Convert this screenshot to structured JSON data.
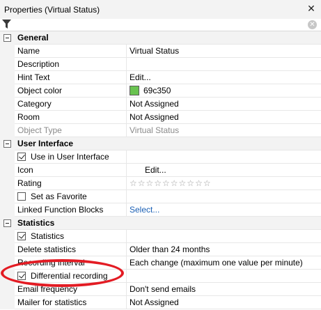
{
  "panel": {
    "title": "Properties (Virtual Status)"
  },
  "filter": {
    "placeholder": ""
  },
  "colors": {
    "object_color": "#69c350",
    "annotation": "#e31b23"
  },
  "general": {
    "label": "General",
    "name_label": "Name",
    "name_value": "Virtual Status",
    "description_label": "Description",
    "description_value": "",
    "hint_label": "Hint Text",
    "hint_value": "Edit...",
    "color_label": "Object color",
    "color_value": "69c350",
    "category_label": "Category",
    "category_value": "Not Assigned",
    "room_label": "Room",
    "room_value": "Not Assigned",
    "type_label": "Object Type",
    "type_value": "Virtual Status"
  },
  "ui": {
    "label": "User Interface",
    "use_label": "Use in User Interface",
    "use_checked": true,
    "icon_label": "Icon",
    "icon_value": "Edit...",
    "rating_label": "Rating",
    "rating_value": 0,
    "rating_max": 10,
    "favorite_label": "Set as Favorite",
    "favorite_checked": false,
    "linked_label": "Linked Function Blocks",
    "linked_value": "Select..."
  },
  "statistics": {
    "label": "Statistics",
    "stats_label": "Statistics",
    "stats_checked": true,
    "delete_label": "Delete statistics",
    "delete_value": "Older than 24 months",
    "interval_label": "Recording interval",
    "interval_value": "Each change (maximum one value per minute)",
    "diff_label": "Differential recording",
    "diff_checked": true,
    "email_label": "Email frequency",
    "email_value": "Don't send emails",
    "mailer_label": "Mailer for statistics",
    "mailer_value": "Not Assigned"
  }
}
